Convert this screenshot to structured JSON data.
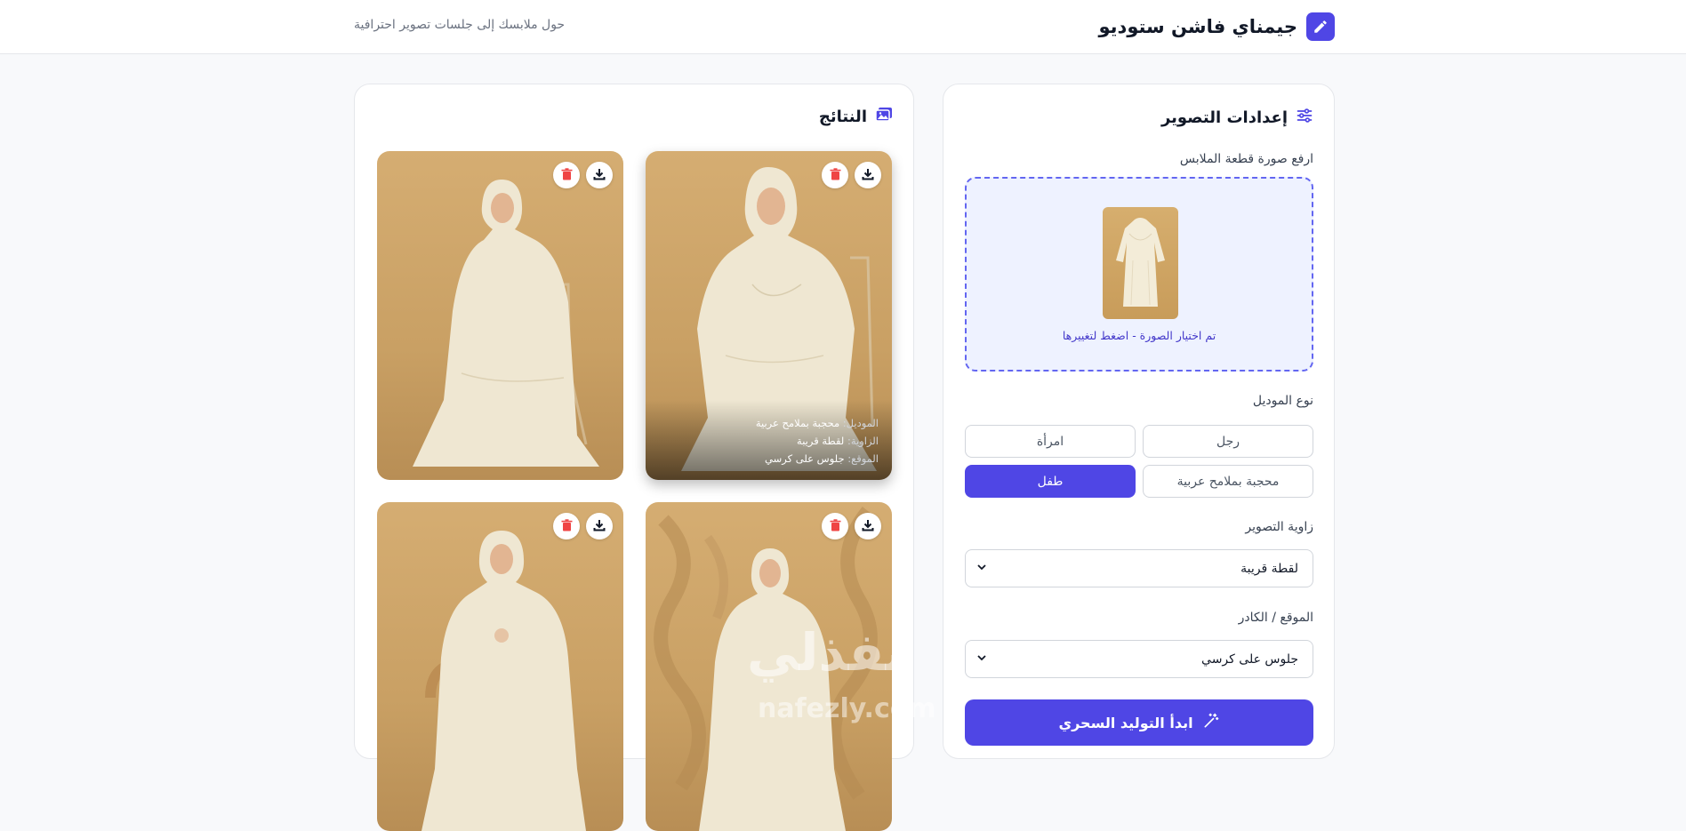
{
  "header": {
    "title": "جيمناي فاشن ستوديو",
    "tagline": "حول ملابسك إلى جلسات تصوير احترافية",
    "logo_icon": "pencil-icon"
  },
  "settings": {
    "title": "إعدادات التصوير",
    "title_icon": "sliders-icon",
    "upload_label": "ارفع صورة قطعة الملابس",
    "upload_hint": "تم اختيار الصورة - اضغط لتغييرها",
    "model_label": "نوع الموديل",
    "model_options": [
      "رجل",
      "امرأة",
      "محجبة بملامح عربية",
      "طفل"
    ],
    "model_selected": "طفل",
    "angle_label": "زاوية التصوير",
    "angle_value": "لقطة قريبة",
    "location_label": "الموقع / الكادر",
    "location_value": "جلوس على كرسي",
    "generate_label": "ابدأ التوليد السحري"
  },
  "results": {
    "title": "النتائج",
    "title_icon": "images-icon",
    "meta_model_key": "الموديل:",
    "meta_model_val": "محجبة بملامح عربية",
    "meta_angle_key": "الزاوية:",
    "meta_angle_val": "لقطة قريبة",
    "meta_location_key": "الموقع:",
    "meta_location_val": "جلوس على كرسي"
  },
  "watermark": {
    "arabic": "نفذلي",
    "latin": "nafezly.com"
  },
  "colors": {
    "accent": "#4f46e5",
    "delete": "#ef4444",
    "background": "#f8f9fb"
  }
}
